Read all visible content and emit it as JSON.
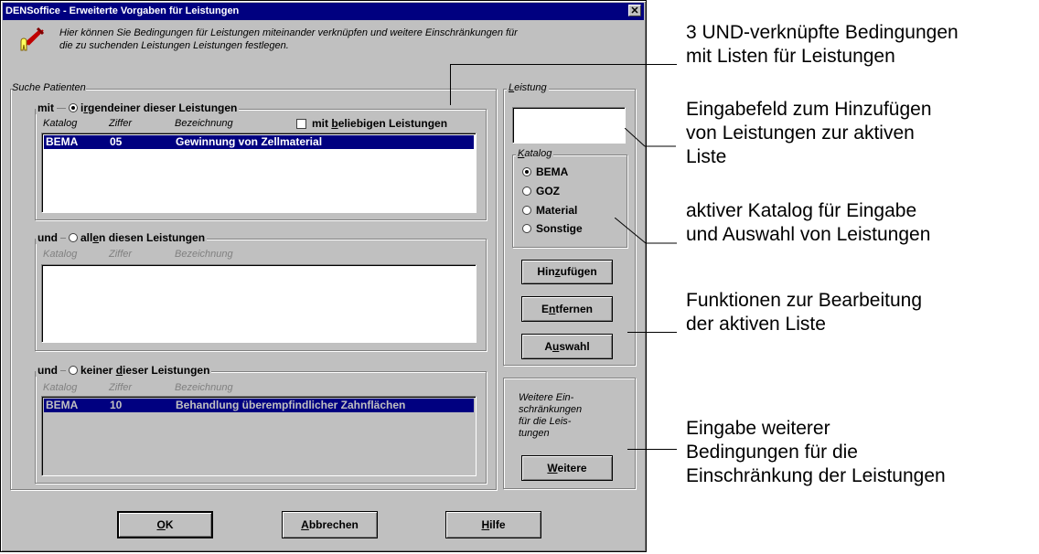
{
  "window": {
    "title": "DENSoffice - Erweiterte Vorgaben für Leistungen",
    "close": "✕"
  },
  "intro": {
    "line1": "Hier können Sie Bedingungen für Leistungen miteinander verknüpfen und weitere Einschränkungen für",
    "line2": "die zu suchenden Leistungen Leistungen festlegen."
  },
  "suche": {
    "title": "Suche Patienten",
    "columns": {
      "katalog": "Katalog",
      "ziffer": "Ziffer",
      "bezeichnung": "Bezeichnung"
    },
    "group1": {
      "prefix": "mit",
      "label_pre": "i",
      "label_u": "r",
      "label_post": "gendeiner dieser Leistungen",
      "checkbox_pre": "mit ",
      "checkbox_u": "b",
      "checkbox_post": "eliebigen Leistungen",
      "rows": [
        {
          "katalog": "BEMA",
          "ziffer": "05",
          "bezeichnung": "Gewinnung von Zellmaterial"
        }
      ]
    },
    "group2": {
      "prefix": "und",
      "label_pre": "all",
      "label_u": "e",
      "label_post": "n diesen Leistungen",
      "rows": []
    },
    "group3": {
      "prefix": "und",
      "label_pre": "keiner ",
      "label_u": "d",
      "label_post": "ieser Leistungen",
      "rows": [
        {
          "katalog": "BEMA",
          "ziffer": "10",
          "bezeichnung": "Behandlung überempfindlicher Zahnflächen"
        }
      ]
    }
  },
  "leistung": {
    "title_u": "L",
    "title_post": "eistung",
    "input_value": "",
    "katalog": {
      "title_u": "K",
      "title_post": "atalog",
      "options": [
        "BEMA",
        "GOZ",
        "Material",
        "Sonstige"
      ],
      "selected": "BEMA"
    },
    "buttons": {
      "hinzufuegen": {
        "pre": "Hin",
        "u": "z",
        "post": "ufügen"
      },
      "entfernen": {
        "pre": "E",
        "u": "n",
        "post": "tfernen"
      },
      "auswahl": {
        "pre": "A",
        "u": "u",
        "post": "swahl"
      }
    }
  },
  "weitere": {
    "note1": "Weitere Ein-",
    "note2": "schränkungen",
    "note3": "für die Leis-",
    "note4": "tungen",
    "button": {
      "u": "W",
      "post": "eitere"
    }
  },
  "footer": {
    "ok": {
      "u": "O",
      "post": "K"
    },
    "abbrechen": {
      "u": "A",
      "post": "bbrechen"
    },
    "hilfe": {
      "u": "H",
      "post": "ilfe"
    }
  },
  "annotations": {
    "a1": [
      "3 UND-verknüpfte Bedingungen",
      "mit Listen für Leistungen"
    ],
    "a2": [
      "Eingabefeld zum Hinzufügen",
      "von Leistungen zur aktiven",
      "Liste"
    ],
    "a3": [
      "aktiver Katalog für Eingabe",
      "und Auswahl von Leistungen"
    ],
    "a4": [
      "Funktionen zur Bearbeitung",
      "der aktiven Liste"
    ],
    "a5": [
      "Eingabe weiterer",
      "Bedingungen für die",
      "Einschränkung der Leistungen"
    ]
  },
  "colors": {
    "dialog_bg": "#c0c0c0",
    "titlebar": "#000080",
    "selection": "#000080"
  },
  "icons": {
    "app": "dental-tools-icon"
  }
}
